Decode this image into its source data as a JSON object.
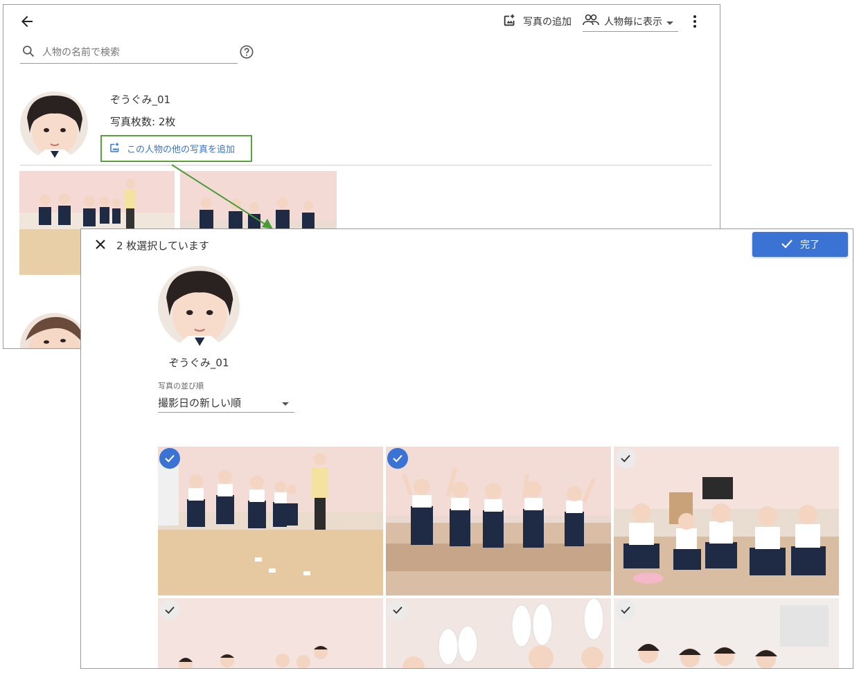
{
  "back": {
    "add_photo_label": "写真の追加",
    "view_mode_label": "人物毎に表示",
    "search_placeholder": "人物の名前で検索",
    "person_name": "ぞうぐみ_01",
    "photo_count": "写真枚数: 2枚",
    "add_more_label": "この人物の他の写真を追加"
  },
  "dialog": {
    "selected_count": "2 枚選択しています",
    "done_label": "完了",
    "person_name": "ぞうぐみ_01",
    "sort_label": "写真の並び順",
    "sort_value": "撮影日の新しい順",
    "photos": [
      {
        "selected": true
      },
      {
        "selected": true
      },
      {
        "selected": false
      },
      {
        "selected": false
      },
      {
        "selected": false
      },
      {
        "selected": false
      }
    ]
  },
  "colors": {
    "accent": "#3a73d4",
    "highlight_border": "#5aa23c",
    "arrow": "#4a9a3a"
  }
}
